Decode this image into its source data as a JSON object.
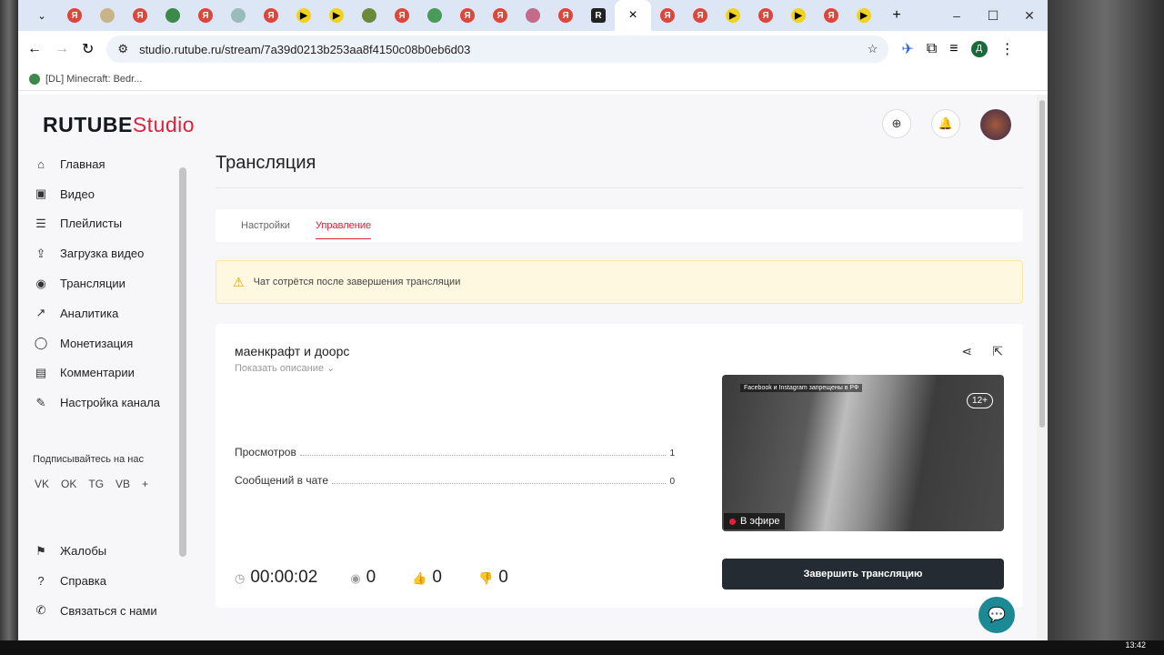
{
  "browser": {
    "url": "studio.rutube.ru/stream/7a39d0213b253aa8f4150c08b0eb6d03",
    "bookmark": "[DL] Minecraft: Bedr...",
    "tab_close": "×",
    "new_tab": "+",
    "win_min": "–",
    "win_max": "☐",
    "win_close": "✕"
  },
  "logo": {
    "main": "RUTUBE",
    "sub": "Studio"
  },
  "sidebar": {
    "items": [
      {
        "label": "Главная",
        "icon": "⌂"
      },
      {
        "label": "Видео",
        "icon": "▣"
      },
      {
        "label": "Плейлисты",
        "icon": "☰"
      },
      {
        "label": "Загрузка видео",
        "icon": "⇪"
      },
      {
        "label": "Трансляции",
        "icon": "◉"
      },
      {
        "label": "Аналитика",
        "icon": "↗"
      },
      {
        "label": "Монетизация",
        "icon": "◯"
      },
      {
        "label": "Комментарии",
        "icon": "▤"
      },
      {
        "label": "Настройка канала",
        "icon": "✎"
      }
    ],
    "follow_label": "Подписывайтесь на нас",
    "socials": [
      "VK",
      "OK",
      "TG",
      "VB",
      "+"
    ],
    "bottom": [
      {
        "label": "Жалобы",
        "icon": "⚑"
      },
      {
        "label": "Справка",
        "icon": "?"
      },
      {
        "label": "Связаться с нами",
        "icon": "✆"
      }
    ]
  },
  "main": {
    "title": "Трансляция",
    "tabs": [
      "Настройки",
      "Управление"
    ],
    "warning": "Чат сотрётся после завершения трансляции",
    "stream": {
      "title": "маенкрафт и доорс",
      "show_desc": "Показать описание ⌄",
      "stats": [
        {
          "label": "Просмотров",
          "value": "1"
        },
        {
          "label": "Сообщений в чате",
          "value": "0"
        }
      ],
      "banner": "Facebook и Instagram запрещены в РФ",
      "age": "12+",
      "live": "В эфире",
      "end_button": "Завершить трансляцию",
      "duration": "00:00:02",
      "viewers": "0",
      "likes": "0",
      "dislikes": "0"
    }
  },
  "taskbar": {
    "time": "13:42"
  }
}
